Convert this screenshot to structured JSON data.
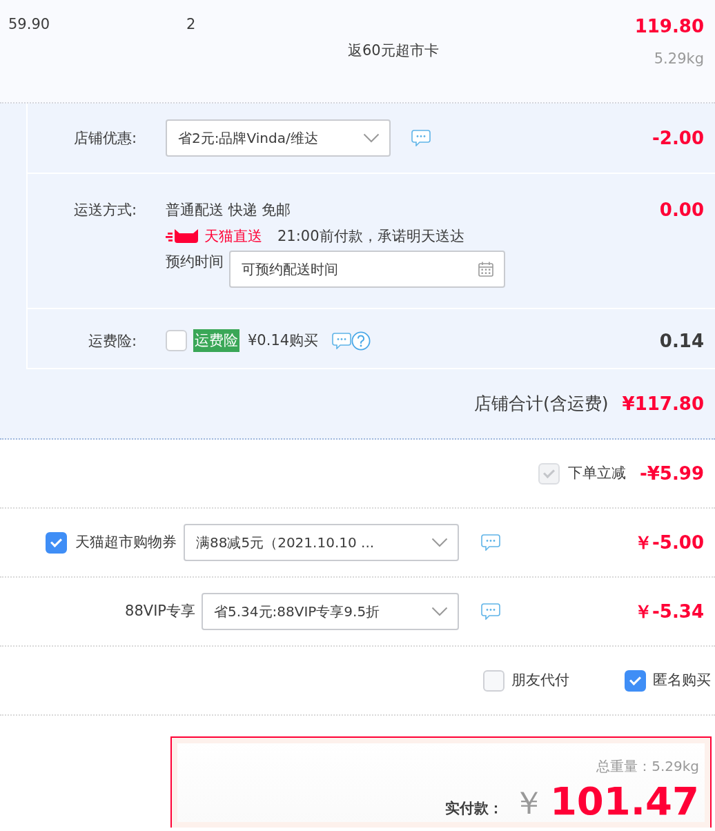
{
  "item": {
    "unit_price": "59.90",
    "quantity": "2",
    "promo": "返60元超市卡",
    "subtotal": "119.80",
    "weight": "5.29kg"
  },
  "store": {
    "discount": {
      "label": "店铺优惠:",
      "selection": "省2元:品牌Vinda/维达",
      "amount": "-2.00"
    },
    "shipping": {
      "label": "运送方式:",
      "method": "普通配送 快递 免邮",
      "badge": "天猫直送",
      "promise": "21:00前付款，承诺明天送达",
      "schedule_label": "预约时间",
      "schedule_value": "可预约配送时间",
      "amount": "0.00"
    },
    "insurance": {
      "label": "运费险:",
      "checked": false,
      "tag": "运费险",
      "price": "¥0.14购买",
      "amount": "0.14"
    },
    "total": {
      "label": "店铺合计(含运费)",
      "amount": "¥117.80"
    }
  },
  "discounts": [
    {
      "kind": "toggle",
      "label": "下单立减",
      "checked": true,
      "disabled": true,
      "amount": "-¥5.99"
    },
    {
      "kind": "select",
      "label": "天猫超市购物券",
      "checked": true,
      "selection": "满88减5元（2021.10.10 ...",
      "amount": "￥-5.00"
    },
    {
      "kind": "select",
      "label": "88VIP专享",
      "selection": "省5.34元:88VIP专享9.5折",
      "amount": "￥-5.34"
    }
  ],
  "options": [
    {
      "label": "朋友代付",
      "checked": false
    },
    {
      "label": "匿名购买",
      "checked": true
    }
  ],
  "summary": {
    "weight_label": "总重量：",
    "weight": "5.29kg",
    "pay_label": "实付款：",
    "currency": "￥",
    "amount": "101.47"
  }
}
